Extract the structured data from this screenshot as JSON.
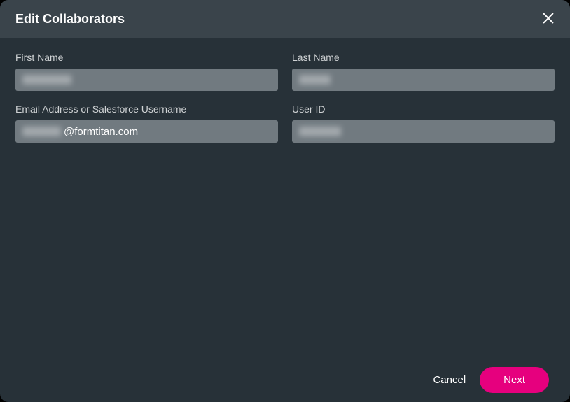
{
  "header": {
    "title": "Edit Collaborators"
  },
  "fields": {
    "first_name": {
      "label": "First Name",
      "value": ""
    },
    "last_name": {
      "label": "Last Name",
      "value": ""
    },
    "email": {
      "label": "Email Address or Salesforce Username",
      "prefix_value": "",
      "suffix": "@formtitan.com"
    },
    "user_id": {
      "label": "User ID",
      "value": ""
    }
  },
  "actions": {
    "cancel": "Cancel",
    "next": "Next"
  },
  "colors": {
    "accent": "#E6007E",
    "panel": "#273138",
    "header": "#3a444b",
    "input": "#717a80"
  }
}
